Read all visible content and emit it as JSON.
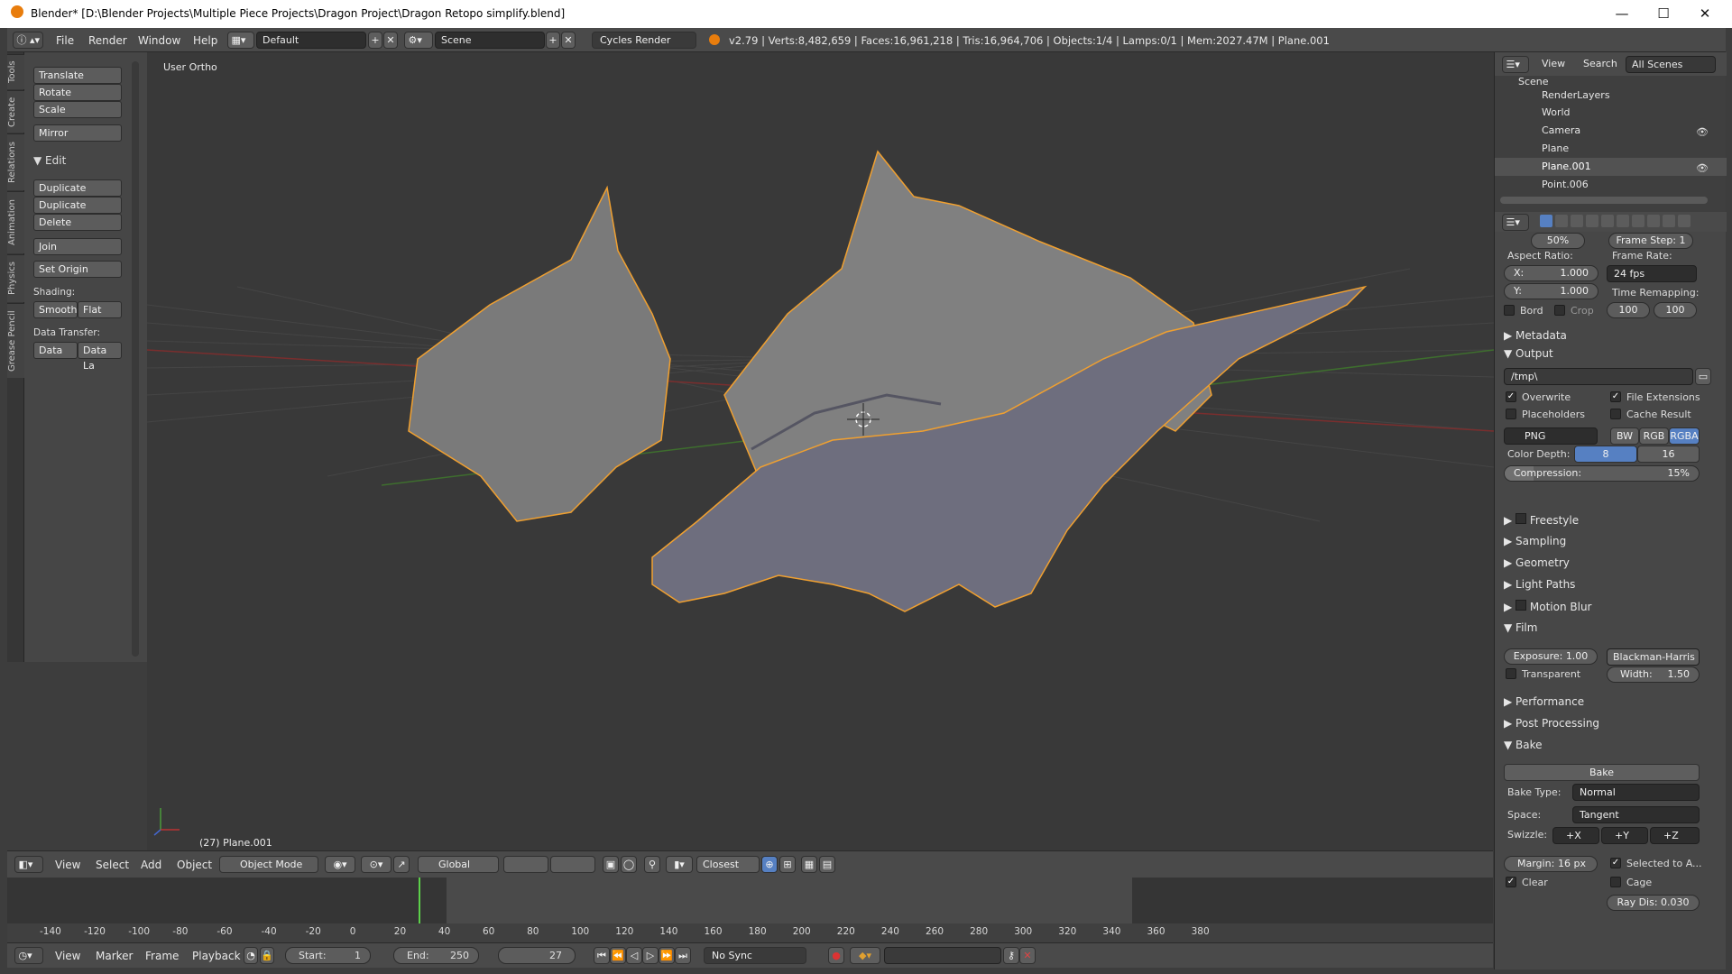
{
  "window": {
    "title": "Blender* [D:\\Blender Projects\\Multiple Piece Projects\\Dragon Project\\Dragon Retopo simplify.blend]",
    "controls": [
      "—",
      "☐",
      "✕"
    ]
  },
  "infobar": {
    "menus": [
      "File",
      "Render",
      "Window",
      "Help"
    ],
    "layout": "Default",
    "scene": "Scene",
    "engine": "Cycles Render",
    "stats": "v2.79 | Verts:8,482,659 | Faces:16,961,218 | Tris:16,964,706 | Objects:1/4 | Lamps:0/1 | Mem:2027.47M | Plane.001"
  },
  "left_tabs": [
    "Tools",
    "Create",
    "Relations",
    "Animation",
    "Physics",
    "Grease Pencil"
  ],
  "tools": {
    "transform": [
      "Translate",
      "Rotate",
      "Scale"
    ],
    "mirror": "Mirror",
    "edit_header": "Edit",
    "edit": [
      "Duplicate",
      "Duplicate Linked",
      "Delete"
    ],
    "join": "Join",
    "set_origin": "Set Origin",
    "shading_label": "Shading:",
    "smooth": "Smooth",
    "flat": "Flat",
    "data_transfer_label": "Data Transfer:",
    "data": "Data",
    "data_la": "Data La"
  },
  "viewport": {
    "view_name": "User Ortho",
    "object_info": "(27) Plane.001"
  },
  "outliner": {
    "menus": [
      "View",
      "Search"
    ],
    "filter": "All Scenes",
    "items": [
      {
        "label": "Scene"
      },
      {
        "label": "RenderLayers"
      },
      {
        "label": "World"
      },
      {
        "label": "Camera"
      },
      {
        "label": "Plane"
      },
      {
        "label": "Plane.001"
      },
      {
        "label": "Point.006"
      }
    ]
  },
  "properties": {
    "top_partial": {
      "resolution_pct": "50%",
      "frame_step": "Frame Step: 1"
    },
    "aspect_ratio_label": "Aspect Ratio:",
    "aspect_x": "X:",
    "aspect_x_val": "1.000",
    "aspect_y": "Y:",
    "aspect_y_val": "1.000",
    "frame_rate_label": "Frame Rate:",
    "frame_rate": "24 fps",
    "time_remap_label": "Time Remapping:",
    "remap_old": "100",
    "remap_new": "100",
    "border": "Bord",
    "crop": "Crop",
    "metadata": "Metadata",
    "output": "Output",
    "output_path": "/tmp\\",
    "overwrite": "Overwrite",
    "file_extensions": "File Extensions",
    "placeholders": "Placeholders",
    "cache_result": "Cache Result",
    "format": "PNG",
    "bw": "BW",
    "rgb": "RGB",
    "rgba": "RGBA",
    "color_depth_label": "Color Depth:",
    "depth_8": "8",
    "depth_16": "16",
    "compression_label": "Compression:",
    "compression_value": "15%",
    "compression_fraction": 0.15,
    "freestyle": "Freestyle",
    "sampling": "Sampling",
    "geometry": "Geometry",
    "light_paths": "Light Paths",
    "motion_blur": "Motion Blur",
    "film": "Film",
    "exposure": "Exposure: 1.00",
    "filter": "Blackman-Harris",
    "transparent": "Transparent",
    "width": "Width:",
    "width_val": "1.50",
    "performance": "Performance",
    "post_processing": "Post Processing",
    "bake_header": "Bake",
    "bake_button": "Bake",
    "bake_type_label": "Bake Type:",
    "bake_type": "Normal",
    "space_label": "Space:",
    "space": "Tangent",
    "swizzle_label": "Swizzle:",
    "swizzle": [
      "+X",
      "+Y",
      "+Z"
    ],
    "margin": "Margin:",
    "margin_val": "16 px",
    "selected_to_active": "Selected to A...",
    "clear": "Clear",
    "cage": "Cage",
    "ray_dis": "Ray Dis: 0.030"
  },
  "view3d_header": {
    "menus": [
      "View",
      "Select",
      "Add",
      "Object"
    ],
    "mode": "Object Mode",
    "orientation": "Global",
    "snap": "Closest"
  },
  "timeline": {
    "ticks": [
      "-140",
      "-120",
      "-100",
      "-80",
      "-60",
      "-40",
      "-20",
      "0",
      "20",
      "40",
      "60",
      "80",
      "100",
      "120",
      "140",
      "160",
      "180",
      "200",
      "220",
      "240",
      "260",
      "280",
      "300",
      "320",
      "340",
      "360",
      "380"
    ],
    "current_frame": 27,
    "range_start": 1,
    "range_end": 250
  },
  "timeline_header": {
    "menus": [
      "View",
      "Marker",
      "Frame",
      "Playback"
    ],
    "start_label": "Start:",
    "start": "1",
    "end_label": "End:",
    "end": "250",
    "current": "27",
    "sync": "No Sync"
  },
  "colors": {
    "accent_blue": "#5680c2",
    "selection_orange": "#f0a030",
    "frame_green": "#5cd04a"
  }
}
